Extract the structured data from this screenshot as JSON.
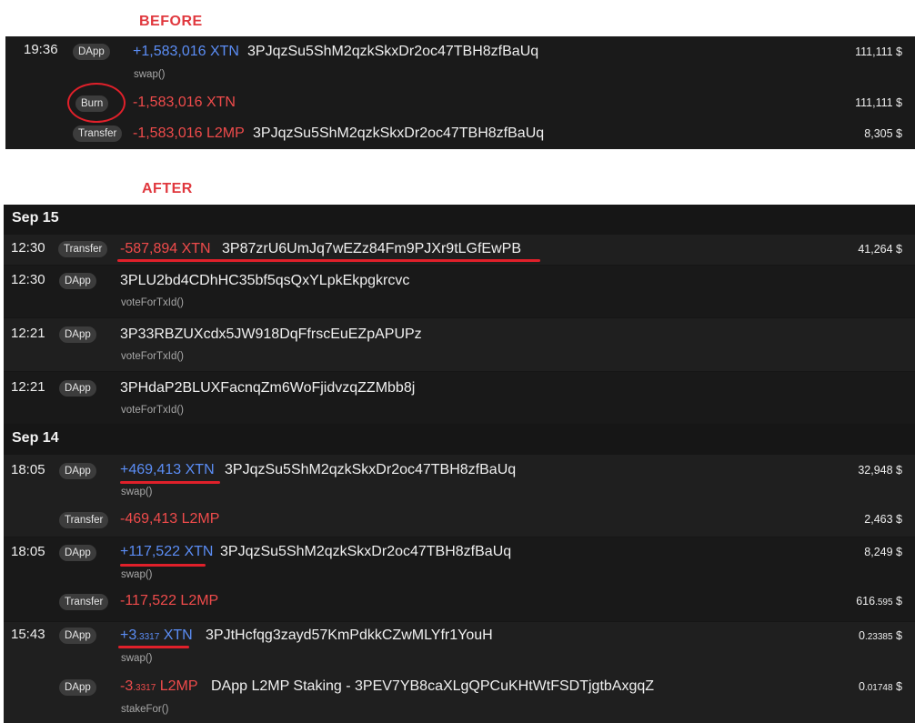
{
  "labels": {
    "before": "BEFORE",
    "after": "AFTER"
  },
  "before": [
    {
      "time": "19:36",
      "type": "DApp",
      "amount": "+1,583,016 XTN",
      "sign": "pos",
      "address": "3PJqzSu5ShM2qzkSkxDr2oc47TBH8zfBaUq",
      "usd": "111,111 $",
      "method": "swap()"
    },
    {
      "time": "",
      "type": "Burn",
      "amount": "-1,583,016 XTN",
      "sign": "neg",
      "address": "",
      "usd": "111,111 $",
      "method": ""
    },
    {
      "time": "",
      "type": "Transfer",
      "amount": "-1,583,016 L2MP",
      "sign": "neg",
      "address": "3PJqzSu5ShM2qzkSkxDr2oc47TBH8zfBaUq",
      "usd": "8,305 $",
      "method": ""
    }
  ],
  "after": {
    "dates": [
      "Sep 15",
      "Sep 14"
    ],
    "rows": [
      {
        "time": "12:30",
        "type": "Transfer",
        "amount": "-587,894 XTN",
        "address": "3P87zrU6UmJq7wEZz84Fm9PJXr9tLGfEwPB",
        "usd": "41,264 $",
        "method": ""
      },
      {
        "time": "12:30",
        "type": "DApp",
        "amount": "",
        "address": "3PLU2bd4CDhHC35bf5qsQxYLpkEkpgkrcvc",
        "usd": "",
        "method": "voteForTxId()"
      },
      {
        "time": "12:21",
        "type": "DApp",
        "amount": "",
        "address": "3P33RBZUXcdx5JW918DqFfrscEuEZpAPUPz",
        "usd": "",
        "method": "voteForTxId()"
      },
      {
        "time": "12:21",
        "type": "DApp",
        "amount": "",
        "address": "3PHdaP2BLUXFacnqZm6WoFjidvzqZZMbb8j",
        "usd": "",
        "method": "voteForTxId()"
      },
      {
        "time": "18:05",
        "type": "DApp",
        "amount": "+469,413 XTN",
        "address": "3PJqzSu5ShM2qzkSkxDr2oc47TBH8zfBaUq",
        "usd": "32,948 $",
        "method": "swap()"
      },
      {
        "time": "",
        "type": "Transfer",
        "amount": "-469,413 L2MP",
        "address": "",
        "usd": "2,463 $",
        "method": ""
      },
      {
        "time": "18:05",
        "type": "DApp",
        "amount": "+117,522 XTN",
        "address": "3PJqzSu5ShM2qzkSkxDr2oc47TBH8zfBaUq",
        "usd": "8,249 $",
        "method": "swap()"
      },
      {
        "time": "",
        "type": "Transfer",
        "amount": "-117,522 L2MP",
        "address": "",
        "usd_main": "616",
        "usd_small": ".595",
        "usd_unit": " $",
        "method": ""
      },
      {
        "time": "15:43",
        "type": "DApp",
        "amount_main": "+3",
        "amount_small": ".3317",
        "amount_unit": " XTN",
        "address": "3PJtHcfqg3zayd57KmPdkkCZwMLYfr1YouH",
        "usd_main": "0",
        "usd_small": ".23385",
        "usd_unit": " $",
        "method": "swap()"
      },
      {
        "time": "",
        "type": "DApp",
        "amount_main": "-3",
        "amount_small": ".3317",
        "amount_unit": " L2MP",
        "address": "DApp L2MP Staking - 3PEV7YB8caXLgQPCuKHtWtFSDTjgtbAxgqZ",
        "usd_main": "0",
        "usd_small": ".01748",
        "usd_unit": " $",
        "method": "stakeFor()"
      }
    ]
  },
  "colors": {
    "positive": "#5b8df5",
    "negative": "#ef4b4b",
    "annotation": "#e0202a"
  }
}
